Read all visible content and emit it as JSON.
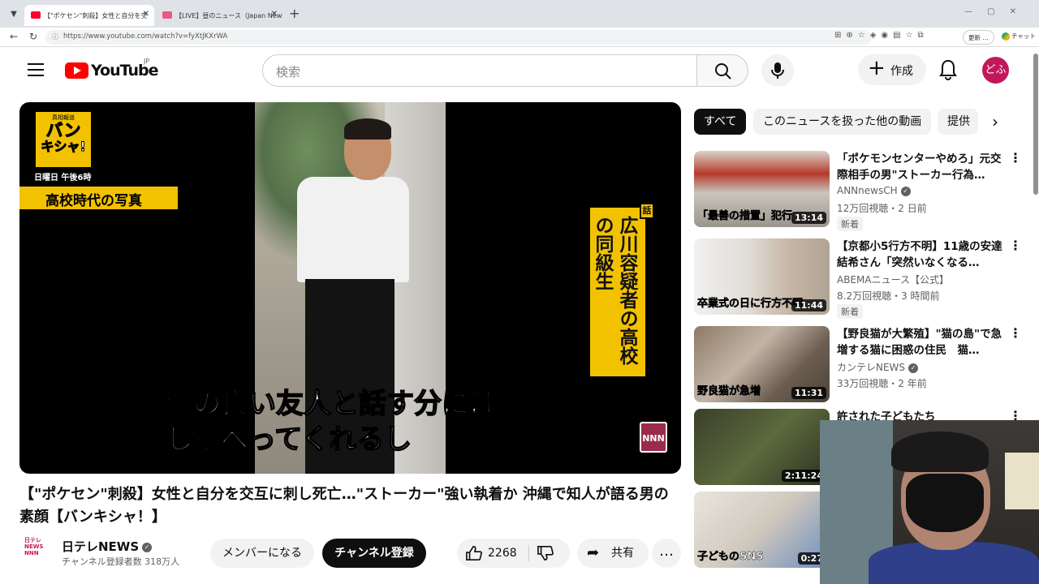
{
  "browser": {
    "tabs": [
      {
        "label": "【\"ポケセン\"刺殺】女性と自分を交"
      },
      {
        "label": "【LIVE】昼のニュース（Japan News Di"
      }
    ],
    "url": "https://www.youtube.com/watch?v=fyXtJKXrWA",
    "update_label": "更新 …",
    "chat_label": "チャット"
  },
  "header": {
    "logo_text": "YouTube",
    "region": "JP",
    "search_placeholder": "検索",
    "create_label": "作成",
    "avatar_text": "どふ"
  },
  "player": {
    "badge_small": "真相報道",
    "badge_line1": "バン",
    "badge_line2": "キシャ!",
    "schedule": "日曜日 午後6時",
    "photo_caption": "高校時代の写真",
    "vertical_tag": "話",
    "vertical_caption": "広川容疑者の高校の同級生",
    "subtitle_line1": "仲の良い友人と話す分には",
    "subtitle_line2": "しゃべってくれるし",
    "watermark": "NNN"
  },
  "video": {
    "title": "【\"ポケセン\"刺殺】女性と自分を交互に刺し死亡…\"ストーカー\"強い執着か 沖縄で知人が語る男の素顔【バンキシャ！】"
  },
  "channel": {
    "avatar_text": "日テレNEWS NNN",
    "name": "日テレNEWS",
    "subscribers": "チャンネル登録者数 318万人",
    "member_label": "メンバーになる",
    "subscribe_label": "チャンネル登録",
    "likes": "2268",
    "share_label": "共有"
  },
  "chips": {
    "items": [
      {
        "label": "すべて"
      },
      {
        "label": "このニュースを扱った他の動画"
      },
      {
        "label": "提供"
      }
    ]
  },
  "recommendations": [
    {
      "title": "「ポケモンセンターやめろ」元交際相手の男\"ストーカー行為…",
      "channel": "ANNnewsCH",
      "meta": "12万回視聴・2 日前",
      "badge": "新着",
      "duration": "13:14",
      "thumb_text": "「最善の措置」犯行"
    },
    {
      "title": "【京都小5行方不明】11歳の安達結希さん「突然いなくなる…",
      "channel": "ABEMAニュース【公式】",
      "meta": "8.2万回視聴・3 時間前",
      "badge": "新着",
      "duration": "11:44",
      "thumb_text": "卒業式の日に行方不明"
    },
    {
      "title": "【野良猫が大繁殖】\"猫の島\"で急増する猫に困惑の住民　猫…",
      "channel": "カンテレNEWS",
      "meta": "33万回視聴・2 年前",
      "badge": "",
      "duration": "11:31",
      "thumb_text": "野良猫が急増"
    },
    {
      "title": "許された子どもたち",
      "channel": "",
      "meta": "",
      "badge": "",
      "duration": "2:11:24",
      "thumb_text": ""
    },
    {
      "title": "",
      "channel": "",
      "meta": "",
      "badge": "",
      "duration": "0:27",
      "thumb_text": "子どものSNS"
    }
  ],
  "colors": {
    "brand_red": "#ff0000",
    "caption_yellow": "#f2c200",
    "avatar_pink": "#c2185b"
  }
}
